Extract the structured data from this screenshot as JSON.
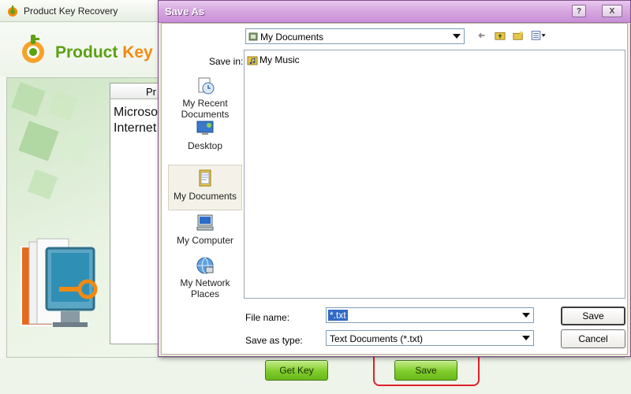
{
  "app": {
    "window_title": "Product Key Recovery",
    "brand": {
      "part1": "Product",
      "part2": "Key"
    },
    "results_header": "Pr",
    "results": [
      "Microsof",
      "Internet"
    ],
    "buttons": {
      "get_key": "Get Key",
      "save": "Save"
    }
  },
  "dialog": {
    "title": "Save As",
    "title_buttons": {
      "help": "?",
      "close": "X"
    },
    "save_in_label": "Save in:",
    "save_in_value": "My Documents",
    "places": [
      {
        "label": "My Recent Documents",
        "icon": "recent-documents-icon"
      },
      {
        "label": "Desktop",
        "icon": "desktop-icon"
      },
      {
        "label": "My Documents",
        "icon": "my-documents-icon",
        "selected": true
      },
      {
        "label": "My Computer",
        "icon": "my-computer-icon"
      },
      {
        "label": "My Network Places",
        "icon": "network-places-icon"
      }
    ],
    "files": [
      {
        "name": "My Music",
        "icon": "music-folder-icon"
      }
    ],
    "file_name_label": "File name:",
    "file_name_value": "*.txt",
    "save_as_type_label": "Save as type:",
    "save_as_type_value": "Text Documents (*.txt)",
    "save_button": "Save",
    "cancel_button": "Cancel"
  },
  "colors": {
    "brand_green": "#5ba113",
    "brand_orange": "#f08a12",
    "dialog_titlebar": "#d7a9e0",
    "highlight_red": "#e0202a",
    "selection_blue": "#316ac5"
  }
}
